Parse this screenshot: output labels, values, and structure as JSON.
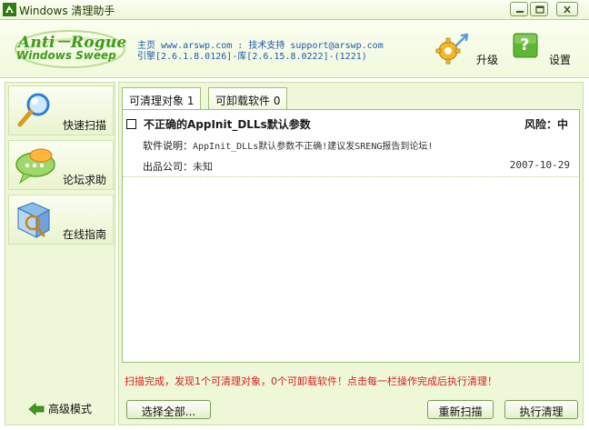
{
  "window": {
    "title": "Windows 清理助手",
    "icon": "app-icon",
    "buttons": [
      "minimize-icon",
      "maximize-icon",
      "close-icon"
    ]
  },
  "header": {
    "logo_line1": "Anti－Rogue",
    "logo_line2": "Windows Sweep",
    "info_line1": "主页 www.arswp.com : 技术支持 support@arswp.com",
    "info_line2": "引擎[2.6.1.8.0126]-库[2.6.15.8.0222]-(1221)",
    "upgrade_label": "升级",
    "settings_label": "设置",
    "settings_icon_glyph": "?"
  },
  "sidebar": {
    "items": [
      {
        "label": "快速扫描",
        "icon": "magnifier-icon"
      },
      {
        "label": "论坛求助",
        "icon": "chat-bubble-icon"
      },
      {
        "label": "在线指南",
        "icon": "guide-book-icon"
      }
    ],
    "advanced_label": "高级模式",
    "advanced_icon": "back-arrow-icon"
  },
  "tabs": [
    {
      "label": "可清理对象 1",
      "active": true
    },
    {
      "label": "可卸载软件 0",
      "active": false
    }
  ],
  "entries": [
    {
      "title": "不正确的AppInit_DLLs默认参数",
      "risk": "风险：中",
      "desc_label": "软件说明：",
      "desc_value": "AppInit_DLLs默认参数不正确!建议发SRENG报告到论坛!",
      "company_label": "出品公司：",
      "company_value": "未知",
      "date": "2007-10-29"
    }
  ],
  "status_text": "扫描完成，发现1个可清理对象，0个可卸载软件！点击每一栏操作完成后执行清理！",
  "buttons": {
    "select_all": "选择全部...",
    "rescan": "重新扫描",
    "execute": "执行清理"
  },
  "colors": {
    "accent_green": "#3d9b1b",
    "link_blue": "#1f58a8",
    "status_red": "#d41f1f",
    "panel_bg": "#eef7d7"
  }
}
